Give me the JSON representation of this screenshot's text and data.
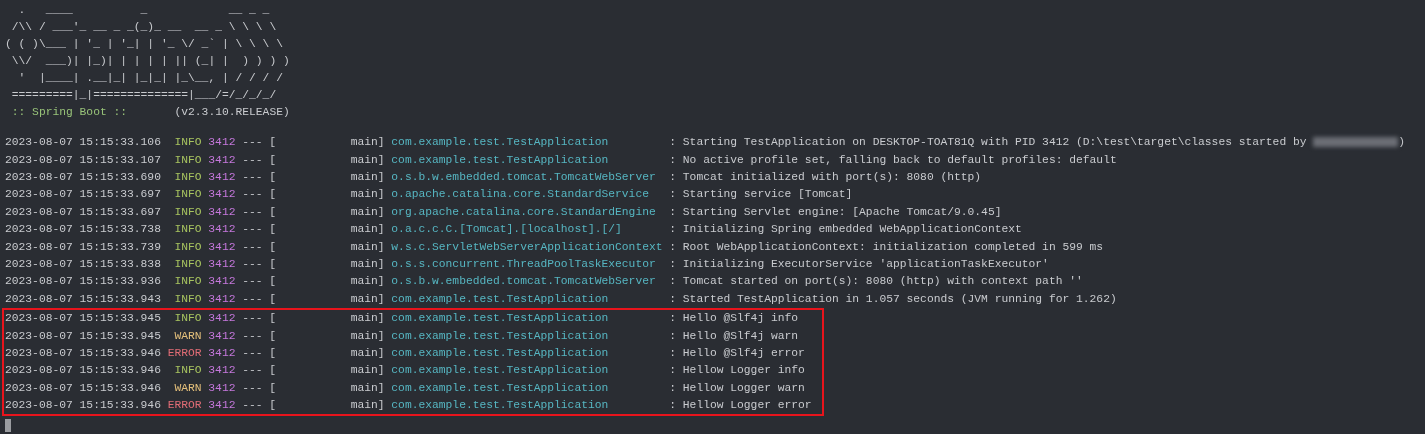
{
  "banner": {
    "art": [
      "  .   ____          _            __ _ _",
      " /\\\\ / ___'_ __ _ _(_)_ __  __ _ \\ \\ \\ \\",
      "( ( )\\___ | '_ | '_| | '_ \\/ _` | \\ \\ \\ \\",
      " \\\\/  ___)| |_)| | | | | || (_| |  ) ) ) )",
      "  '  |____| .__|_| |_|_| |_\\__, | / / / /",
      " =========|_|==============|___/=/_/_/_/"
    ],
    "label": " :: Spring Boot :: ",
    "version": "      (v2.3.10.RELEASE)"
  },
  "log": [
    {
      "date": "2023-08-07 15:15:33.106",
      "level": "INFO",
      "color": "#a7c35f",
      "pid": "3412",
      "dashes": "---",
      "open": "[",
      "thread": "main]",
      "logger": "com.example.test.TestApplication",
      "message": ": Starting TestApplication on DESKTOP-TOAT81Q with PID 3412 (D:\\test\\target\\classes started by",
      "redacted": true,
      "message_tail": ")"
    },
    {
      "date": "2023-08-07 15:15:33.107",
      "level": "INFO",
      "color": "#a7c35f",
      "pid": "3412",
      "dashes": "---",
      "open": "[",
      "thread": "main]",
      "logger": "com.example.test.TestApplication",
      "message": ": No active profile set, falling back to default profiles: default"
    },
    {
      "date": "2023-08-07 15:15:33.690",
      "level": "INFO",
      "color": "#a7c35f",
      "pid": "3412",
      "dashes": "---",
      "open": "[",
      "thread": "main]",
      "logger": "o.s.b.w.embedded.tomcat.TomcatWebServer",
      "message": ": Tomcat initialized with port(s): 8080 (http)"
    },
    {
      "date": "2023-08-07 15:15:33.697",
      "level": "INFO",
      "color": "#a7c35f",
      "pid": "3412",
      "dashes": "---",
      "open": "[",
      "thread": "main]",
      "logger": "o.apache.catalina.core.StandardService",
      "message": ": Starting service [Tomcat]"
    },
    {
      "date": "2023-08-07 15:15:33.697",
      "level": "INFO",
      "color": "#a7c35f",
      "pid": "3412",
      "dashes": "---",
      "open": "[",
      "thread": "main]",
      "logger": "org.apache.catalina.core.StandardEngine",
      "message": ": Starting Servlet engine: [Apache Tomcat/9.0.45]"
    },
    {
      "date": "2023-08-07 15:15:33.738",
      "level": "INFO",
      "color": "#a7c35f",
      "pid": "3412",
      "dashes": "---",
      "open": "[",
      "thread": "main]",
      "logger": "o.a.c.c.C.[Tomcat].[localhost].[/]",
      "message": ": Initializing Spring embedded WebApplicationContext"
    },
    {
      "date": "2023-08-07 15:15:33.739",
      "level": "INFO",
      "color": "#a7c35f",
      "pid": "3412",
      "dashes": "---",
      "open": "[",
      "thread": "main]",
      "logger": "w.s.c.ServletWebServerApplicationContext",
      "message": ": Root WebApplicationContext: initialization completed in 599 ms"
    },
    {
      "date": "2023-08-07 15:15:33.838",
      "level": "INFO",
      "color": "#a7c35f",
      "pid": "3412",
      "dashes": "---",
      "open": "[",
      "thread": "main]",
      "logger": "o.s.s.concurrent.ThreadPoolTaskExecutor",
      "message": ": Initializing ExecutorService 'applicationTaskExecutor'"
    },
    {
      "date": "2023-08-07 15:15:33.936",
      "level": "INFO",
      "color": "#a7c35f",
      "pid": "3412",
      "dashes": "---",
      "open": "[",
      "thread": "main]",
      "logger": "o.s.b.w.embedded.tomcat.TomcatWebServer",
      "message": ": Tomcat started on port(s): 8080 (http) with context path ''"
    },
    {
      "date": "2023-08-07 15:15:33.943",
      "level": "INFO",
      "color": "#a7c35f",
      "pid": "3412",
      "dashes": "---",
      "open": "[",
      "thread": "main]",
      "logger": "com.example.test.TestApplication",
      "message": ": Started TestApplication in 1.057 seconds (JVM running for 1.262)"
    }
  ],
  "highlighted_log": [
    {
      "date": "2023-08-07 15:15:33.945",
      "level": "INFO",
      "color": "#a7c35f",
      "pid": "3412",
      "dashes": "---",
      "open": "[",
      "thread": "main]",
      "logger": "com.example.test.TestApplication",
      "message": ": Hello @Slf4j info"
    },
    {
      "date": "2023-08-07 15:15:33.945",
      "level": "WARN",
      "color": "#e5c07b",
      "pid": "3412",
      "dashes": "---",
      "open": "[",
      "thread": "main]",
      "logger": "com.example.test.TestApplication",
      "message": ": Hello @Slf4j warn"
    },
    {
      "date": "2023-08-07 15:15:33.946",
      "level": "ERROR",
      "color": "#e06c75",
      "pid": "3412",
      "dashes": "---",
      "open": "[",
      "thread": "main]",
      "logger": "com.example.test.TestApplication",
      "message": ": Hello @Slf4j error"
    },
    {
      "date": "2023-08-07 15:15:33.946",
      "level": "INFO",
      "color": "#a7c35f",
      "pid": "3412",
      "dashes": "---",
      "open": "[",
      "thread": "main]",
      "logger": "com.example.test.TestApplication",
      "message": ": Hellow Logger info"
    },
    {
      "date": "2023-08-07 15:15:33.946",
      "level": "WARN",
      "color": "#e5c07b",
      "pid": "3412",
      "dashes": "---",
      "open": "[",
      "thread": "main]",
      "logger": "com.example.test.TestApplication",
      "message": ": Hellow Logger warn"
    },
    {
      "date": "2023-08-07 15:15:33.946",
      "level": "ERROR",
      "color": "#e06c75",
      "pid": "3412",
      "dashes": "---",
      "open": "[",
      "thread": "main]",
      "logger": "com.example.test.TestApplication",
      "message": ": Hellow Logger error"
    }
  ]
}
